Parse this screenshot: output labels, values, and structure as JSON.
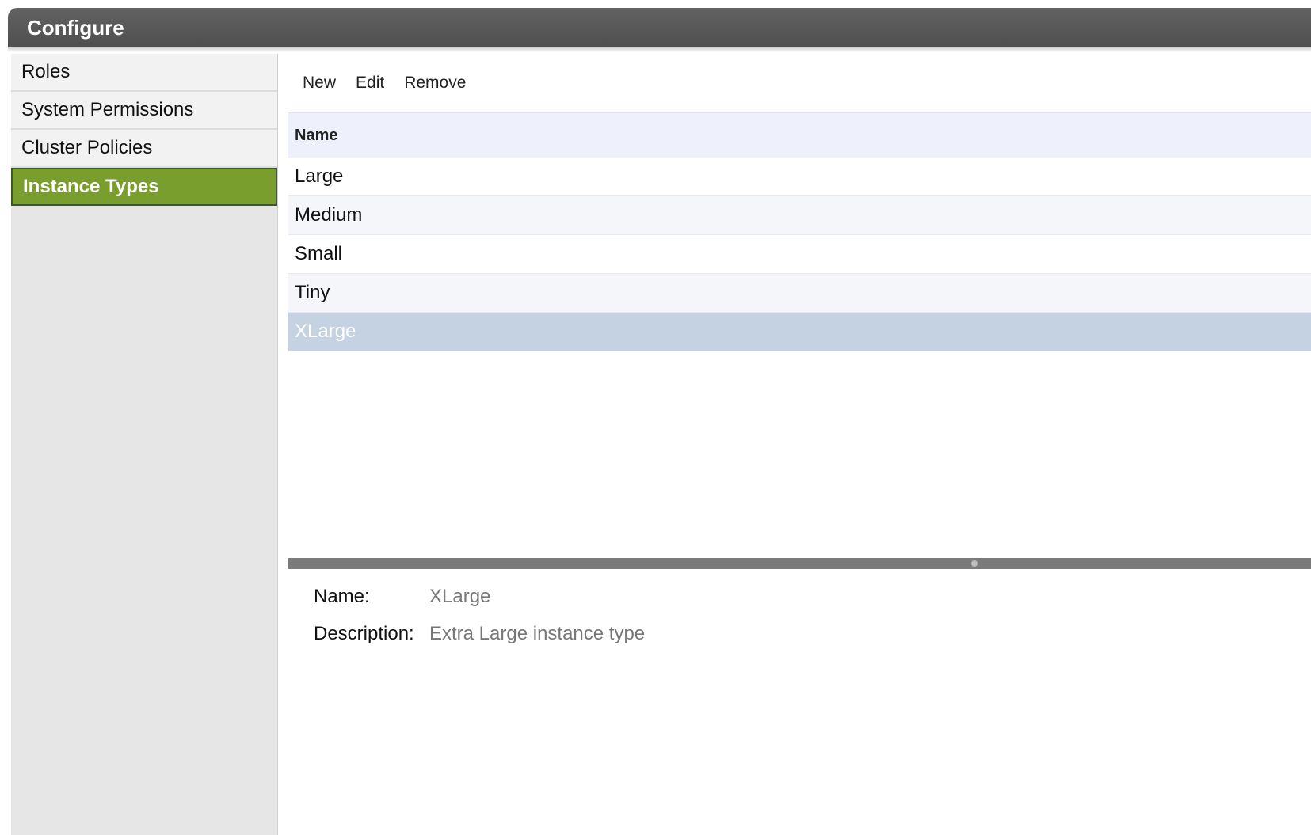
{
  "title": "Configure",
  "sidebar": {
    "items": [
      {
        "label": "Roles"
      },
      {
        "label": "System Permissions"
      },
      {
        "label": "Cluster Policies"
      },
      {
        "label": "Instance Types"
      }
    ]
  },
  "toolbar": {
    "new_label": "New",
    "edit_label": "Edit",
    "remove_label": "Remove"
  },
  "grid": {
    "column_header": "Name",
    "rows": [
      "Large",
      "Medium",
      "Small",
      "Tiny",
      "XLarge"
    ]
  },
  "details": {
    "name_label": "Name:",
    "name_value": "XLarge",
    "description_label": "Description:",
    "description_value": "Extra Large instance type"
  }
}
